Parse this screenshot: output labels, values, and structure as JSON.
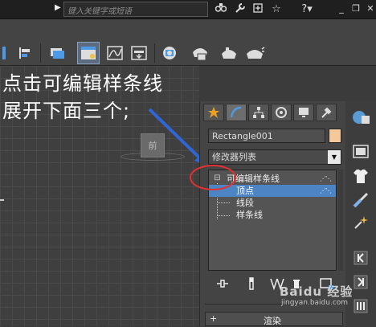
{
  "title_bar": {
    "search_placeholder": "键入关键字或短语",
    "help_label": "?",
    "icons": [
      "binoculars-icon",
      "wrench-icon",
      "star-plus-icon",
      "star-icon",
      "help-icon"
    ],
    "window_controls": [
      "minimize",
      "restore",
      "close"
    ]
  },
  "annotation": {
    "line1": "点击可编辑样条线",
    "line2": "展开下面三个;"
  },
  "viewport": {
    "viewcube_label": "前"
  },
  "command_panel": {
    "tabs": [
      "create-icon",
      "modify-icon",
      "hierarchy-icon",
      "motion-icon",
      "display-icon",
      "utilities-icon"
    ],
    "active_tab_index": 1,
    "object_name": "Rectangle001",
    "object_color": "#f3c89a",
    "modifier_list_label": "修改器列表",
    "stack": {
      "root": "可编辑样条线",
      "root_toggle": "⊟",
      "children": [
        "顶点",
        "线段",
        "样条线"
      ],
      "selected_child_index": 0
    },
    "rollout_toggle": "+",
    "rollout_title": "渲染"
  },
  "watermark": {
    "brand": "Baidu 经验",
    "url": "jingyan.baidu.com"
  },
  "colors": {
    "selection": "#4d84c4",
    "annotation_arrow": "#2f66d8",
    "highlight_circle": "#e53030"
  }
}
